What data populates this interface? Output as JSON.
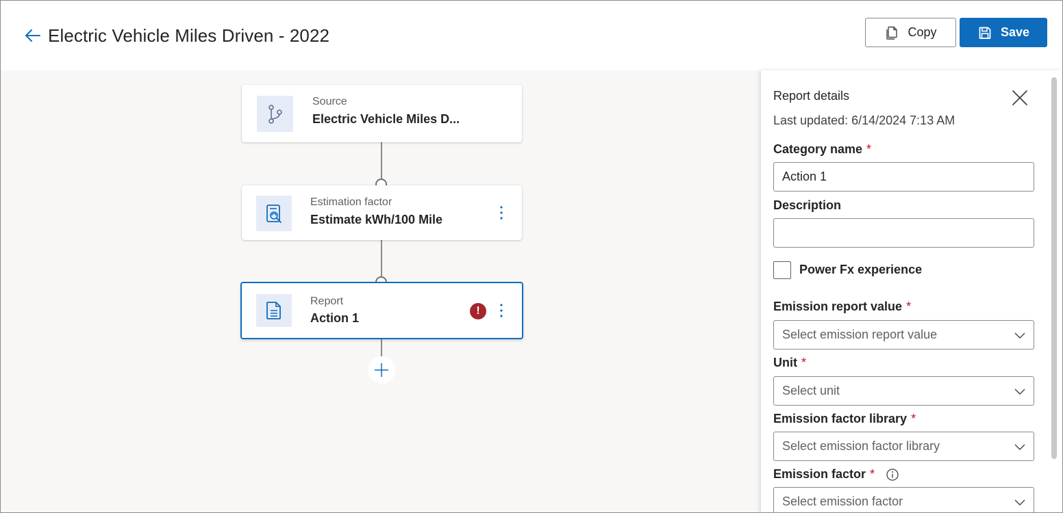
{
  "header": {
    "title": "Electric Vehicle Miles Driven - 2022",
    "copy_label": "Copy",
    "save_label": "Save"
  },
  "flow": {
    "source": {
      "kicker": "Source",
      "title": "Electric Vehicle Miles D..."
    },
    "estimation": {
      "kicker": "Estimation factor",
      "title": "Estimate kWh/100 Mile"
    },
    "report": {
      "kicker": "Report",
      "title": "Action 1",
      "error_symbol": "!"
    }
  },
  "panel": {
    "title": "Report details",
    "last_updated": "Last updated: 6/14/2024 7:13 AM",
    "category_label": "Category name",
    "category_value": "Action 1",
    "description_label": "Description",
    "description_value": "",
    "powerfx_label": "Power Fx experience",
    "powerfx_checked": false,
    "emission_report_label": "Emission report value",
    "emission_report_placeholder": "Select emission report value",
    "unit_label": "Unit",
    "unit_placeholder": "Select unit",
    "library_label": "Emission factor library",
    "library_placeholder": "Select emission factor library",
    "factor_label": "Emission factor",
    "factor_placeholder": "Select emission factor",
    "required_mark": "*"
  },
  "colors": {
    "accent": "#0f6cbd",
    "error": "#a4262c",
    "required": "#c50f1f",
    "canvas_bg": "#f8f7f6",
    "icon_tile_bg": "#e6ecf7"
  },
  "icons": {
    "back": "arrow-left-icon",
    "copy": "copy-icon",
    "save": "save-icon",
    "source": "branch-icon",
    "estimation": "calculator-document-icon",
    "report": "document-icon",
    "more": "more-vertical-icon",
    "add": "plus-icon",
    "close": "close-icon",
    "chevron": "chevron-down-icon",
    "info": "info-icon",
    "error": "error-icon"
  }
}
